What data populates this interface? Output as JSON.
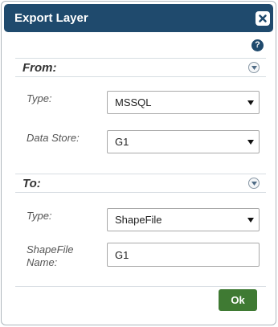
{
  "dialog": {
    "title": "Export Layer",
    "help_glyph": "?",
    "ok_label": "Ok",
    "colors": {
      "titlebar": "#1f4a6d",
      "ok_button": "#3f7a33"
    }
  },
  "from": {
    "title": "From:",
    "type_label": "Type:",
    "type_value": "MSSQL",
    "datastore_label": "Data Store:",
    "datastore_value": "G1"
  },
  "to": {
    "title": "To:",
    "type_label": "Type:",
    "type_value": "ShapeFile",
    "shapefile_label_line1": "ShapeFile",
    "shapefile_label_line2": "Name:",
    "shapefile_value": "G1"
  },
  "icons": [
    "close-icon",
    "help-icon",
    "collapse-icon",
    "chevron-down-icon"
  ]
}
